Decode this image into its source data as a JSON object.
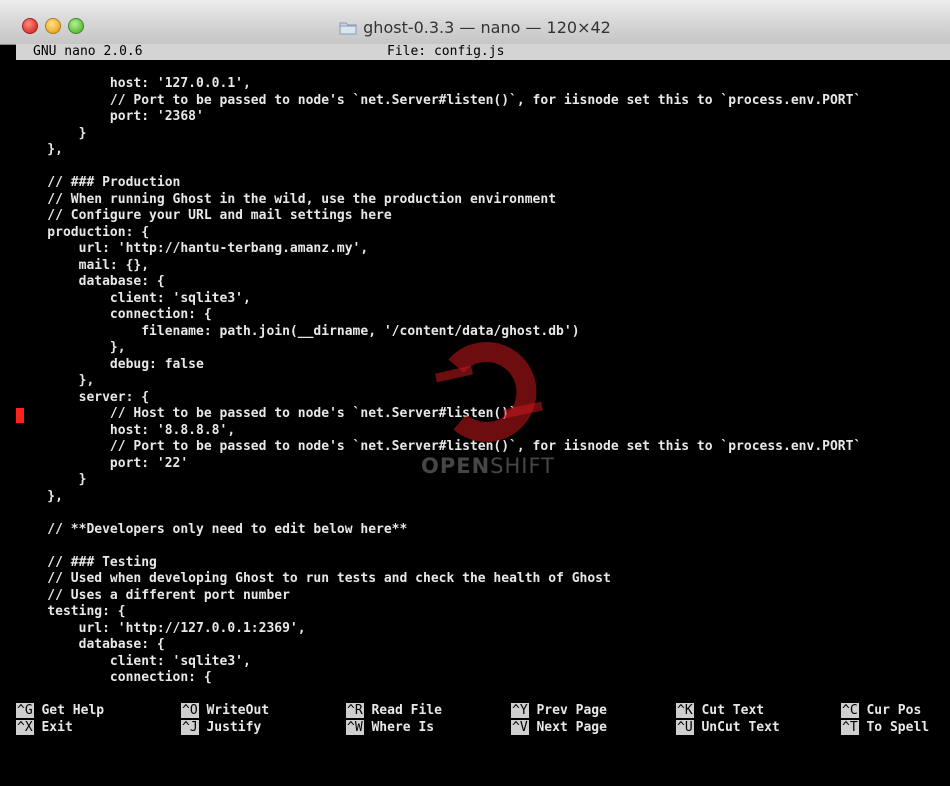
{
  "window": {
    "title": "ghost-0.3.3 — nano — 120×42",
    "folder_icon": "folder-icon"
  },
  "nano": {
    "version": "GNU nano 2.0.6",
    "file_label": "File: config.js"
  },
  "editor": {
    "lines": [
      "            host: '127.0.0.1',",
      "            // Port to be passed to node's `net.Server#listen()`, for iisnode set this to `process.env.PORT`",
      "            port: '2368'",
      "        }",
      "    },",
      "",
      "    // ### Production",
      "    // When running Ghost in the wild, use the production environment",
      "    // Configure your URL and mail settings here",
      "    production: {",
      "        url: 'http://hantu-terbang.amanz.my',",
      "        mail: {},",
      "        database: {",
      "            client: 'sqlite3',",
      "            connection: {",
      "                filename: path.join(__dirname, '/content/data/ghost.db')",
      "            },",
      "            debug: false",
      "        },",
      "        server: {",
      "            // Host to be passed to node's `net.Server#listen()`",
      "            host: '8.8.8.8',",
      "            // Port to be passed to node's `net.Server#listen()`, for iisnode set this to `process.env.PORT`",
      "            port: '22'",
      "        }",
      "    },",
      "",
      "    // **Developers only need to edit below here**",
      "",
      "    // ### Testing",
      "    // Used when developing Ghost to run tests and check the health of Ghost",
      "    // Uses a different port number",
      "    testing: {",
      "        url: 'http://127.0.0.1:2369',",
      "        database: {",
      "            client: 'sqlite3',",
      "            connection: {"
    ]
  },
  "watermark": {
    "brand_open": "OPEN",
    "brand_shift": "SHIFT",
    "logo_color": "#c8171d"
  },
  "shortcuts": [
    {
      "key": "^G",
      "label": "Get Help"
    },
    {
      "key": "^O",
      "label": "WriteOut"
    },
    {
      "key": "^R",
      "label": "Read File"
    },
    {
      "key": "^Y",
      "label": "Prev Page"
    },
    {
      "key": "^K",
      "label": "Cut Text"
    },
    {
      "key": "^C",
      "label": "Cur Pos"
    },
    {
      "key": "^X",
      "label": "Exit"
    },
    {
      "key": "^J",
      "label": "Justify"
    },
    {
      "key": "^W",
      "label": "Where Is"
    },
    {
      "key": "^V",
      "label": "Next Page"
    },
    {
      "key": "^U",
      "label": "UnCut Text"
    },
    {
      "key": "^T",
      "label": "To Spell"
    }
  ]
}
